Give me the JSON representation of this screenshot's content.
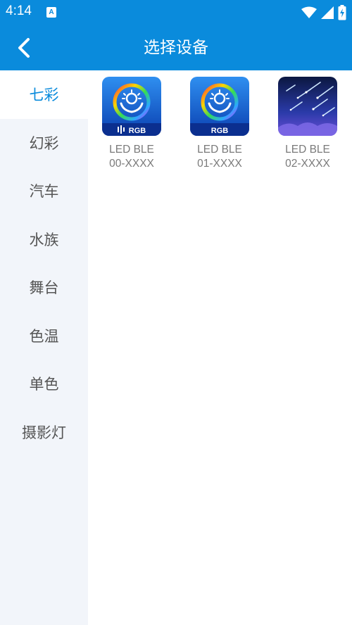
{
  "status_bar": {
    "time": "4:14",
    "icons": [
      "a-notification-icon",
      "wifi-icon",
      "signal-icon",
      "battery-charging-icon"
    ]
  },
  "app_bar": {
    "title": "选择设备",
    "back_icon": "back-arrow-icon"
  },
  "sidebar": {
    "items": [
      {
        "label": "七彩",
        "active": true
      },
      {
        "label": "幻彩",
        "active": false
      },
      {
        "label": "汽车",
        "active": false
      },
      {
        "label": "水族",
        "active": false
      },
      {
        "label": "舞台",
        "active": false
      },
      {
        "label": "色温",
        "active": false
      },
      {
        "label": "单色",
        "active": false
      },
      {
        "label": "摄影灯",
        "active": false
      }
    ]
  },
  "devices": [
    {
      "line1": "LED BLE",
      "line2": "00-XXXX",
      "icon": "rgb-sun-hands-icon",
      "badge": "RGB"
    },
    {
      "line1": "LED BLE",
      "line2": "01-XXXX",
      "icon": "rgb-sun-hands-icon",
      "badge": "RGB"
    },
    {
      "line1": "LED BLE",
      "line2": "02-XXXX",
      "icon": "meteor-night-sky-icon"
    }
  ],
  "colors": {
    "primary": "#0a8bdc",
    "sidebar_bg": "#f2f5fa",
    "text_gray": "#7a7a7a"
  }
}
